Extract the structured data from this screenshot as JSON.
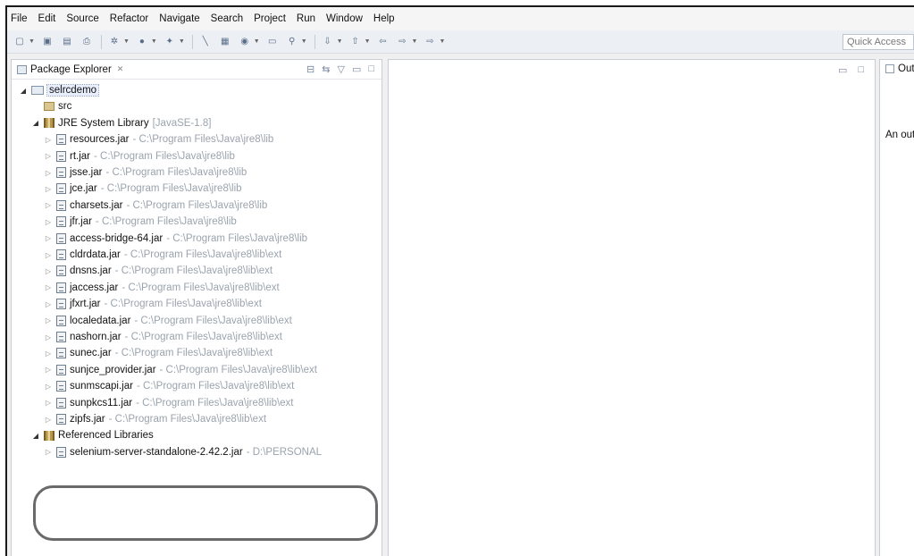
{
  "menubar": {
    "items": [
      "File",
      "Edit",
      "Source",
      "Refactor",
      "Navigate",
      "Search",
      "Project",
      "Run",
      "Window",
      "Help"
    ]
  },
  "toolbar": {
    "quick_access_label": "Quick Access"
  },
  "package_explorer": {
    "title": "Package Explorer",
    "tree": [
      {
        "depth": 0,
        "twisty": "open",
        "icon": "project",
        "name": "selrcdemo",
        "path": "",
        "selected": true
      },
      {
        "depth": 1,
        "twisty": "none",
        "icon": "src",
        "name": "src",
        "path": ""
      },
      {
        "depth": 1,
        "twisty": "open",
        "icon": "lib",
        "name": "JRE System Library",
        "path": "[JavaSE-1.8]"
      },
      {
        "depth": 2,
        "twisty": "closed",
        "icon": "jar",
        "name": "resources.jar",
        "path": "- C:\\Program Files\\Java\\jre8\\lib"
      },
      {
        "depth": 2,
        "twisty": "closed",
        "icon": "jar",
        "name": "rt.jar",
        "path": "- C:\\Program Files\\Java\\jre8\\lib"
      },
      {
        "depth": 2,
        "twisty": "closed",
        "icon": "jar",
        "name": "jsse.jar",
        "path": "- C:\\Program Files\\Java\\jre8\\lib"
      },
      {
        "depth": 2,
        "twisty": "closed",
        "icon": "jar",
        "name": "jce.jar",
        "path": "- C:\\Program Files\\Java\\jre8\\lib"
      },
      {
        "depth": 2,
        "twisty": "closed",
        "icon": "jar",
        "name": "charsets.jar",
        "path": "- C:\\Program Files\\Java\\jre8\\lib"
      },
      {
        "depth": 2,
        "twisty": "closed",
        "icon": "jar",
        "name": "jfr.jar",
        "path": "- C:\\Program Files\\Java\\jre8\\lib"
      },
      {
        "depth": 2,
        "twisty": "closed",
        "icon": "jar",
        "name": "access-bridge-64.jar",
        "path": "- C:\\Program Files\\Java\\jre8\\lib"
      },
      {
        "depth": 2,
        "twisty": "closed",
        "icon": "jar",
        "name": "cldrdata.jar",
        "path": "- C:\\Program Files\\Java\\jre8\\lib\\ext"
      },
      {
        "depth": 2,
        "twisty": "closed",
        "icon": "jar",
        "name": "dnsns.jar",
        "path": "- C:\\Program Files\\Java\\jre8\\lib\\ext"
      },
      {
        "depth": 2,
        "twisty": "closed",
        "icon": "jar",
        "name": "jaccess.jar",
        "path": "- C:\\Program Files\\Java\\jre8\\lib\\ext"
      },
      {
        "depth": 2,
        "twisty": "closed",
        "icon": "jar",
        "name": "jfxrt.jar",
        "path": "- C:\\Program Files\\Java\\jre8\\lib\\ext"
      },
      {
        "depth": 2,
        "twisty": "closed",
        "icon": "jar",
        "name": "localedata.jar",
        "path": "- C:\\Program Files\\Java\\jre8\\lib\\ext"
      },
      {
        "depth": 2,
        "twisty": "closed",
        "icon": "jar",
        "name": "nashorn.jar",
        "path": "- C:\\Program Files\\Java\\jre8\\lib\\ext"
      },
      {
        "depth": 2,
        "twisty": "closed",
        "icon": "jar",
        "name": "sunec.jar",
        "path": "- C:\\Program Files\\Java\\jre8\\lib\\ext"
      },
      {
        "depth": 2,
        "twisty": "closed",
        "icon": "jar",
        "name": "sunjce_provider.jar",
        "path": "- C:\\Program Files\\Java\\jre8\\lib\\ext"
      },
      {
        "depth": 2,
        "twisty": "closed",
        "icon": "jar",
        "name": "sunmscapi.jar",
        "path": "- C:\\Program Files\\Java\\jre8\\lib\\ext"
      },
      {
        "depth": 2,
        "twisty": "closed",
        "icon": "jar",
        "name": "sunpkcs11.jar",
        "path": "- C:\\Program Files\\Java\\jre8\\lib\\ext"
      },
      {
        "depth": 2,
        "twisty": "closed",
        "icon": "jar",
        "name": "zipfs.jar",
        "path": "- C:\\Program Files\\Java\\jre8\\lib\\ext"
      },
      {
        "depth": 1,
        "twisty": "open",
        "icon": "lib",
        "name": "Referenced Libraries",
        "path": ""
      },
      {
        "depth": 2,
        "twisty": "closed",
        "icon": "jar",
        "name": "selenium-server-standalone-2.42.2.jar",
        "path": "- D:\\PERSONAL"
      }
    ]
  },
  "outline": {
    "title": "Outline",
    "message": "An outline is not available."
  }
}
